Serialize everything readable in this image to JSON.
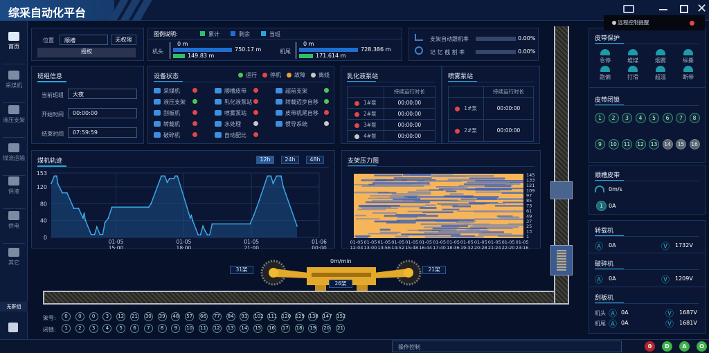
{
  "app": {
    "title": "综采自动化平台"
  },
  "toast": {
    "text": "远程控制提醒"
  },
  "sidebar": {
    "items": [
      {
        "label": "首页"
      },
      {
        "label": "采煤机"
      },
      {
        "label": "液压支架"
      },
      {
        "label": "煤流运输"
      },
      {
        "label": "供液"
      },
      {
        "label": "供电"
      },
      {
        "label": "其它"
      }
    ],
    "group": "无群组"
  },
  "position": {
    "label": "位置",
    "value": "顺槽",
    "permission": "无权限",
    "authorize": "授权"
  },
  "legend": {
    "title": "图例说明:",
    "items": [
      {
        "label": "累计",
        "color": "#2fbf6a"
      },
      {
        "label": "剩余",
        "color": "#1e6fd0"
      },
      {
        "label": "当班",
        "color": "#27a8d8"
      }
    ]
  },
  "head": {
    "label": "机头",
    "start": "0 m",
    "remaining": "750.17 m",
    "shift": "149.83 m"
  },
  "tail": {
    "label": "机尾",
    "start": "0 m",
    "remaining": "728.386 m",
    "shift": "171.614 m"
  },
  "rates": [
    {
      "label": "支架自动跟机率",
      "value": "0.00%"
    },
    {
      "label": "记 忆 截 割 率",
      "value": "0.00%"
    }
  ],
  "shift": {
    "title": "班组信息",
    "rows": [
      {
        "label": "当前班组",
        "value": "大夜"
      },
      {
        "label": "开始时间",
        "value": "00:00:00"
      },
      {
        "label": "结束时间",
        "value": "07:59:59"
      }
    ]
  },
  "devices": {
    "title": "设备状态",
    "legend": [
      {
        "label": "运行",
        "status": "green"
      },
      {
        "label": "停机",
        "status": "red"
      },
      {
        "label": "故障",
        "status": "orange"
      },
      {
        "label": "离线",
        "status": "gray"
      }
    ],
    "items": [
      {
        "label": "采煤机",
        "status": "red"
      },
      {
        "label": "顺槽皮带",
        "status": "red"
      },
      {
        "label": "超前支架",
        "status": "green"
      },
      {
        "label": "液压支架",
        "status": "green"
      },
      {
        "label": "乳化液泵站",
        "status": "red"
      },
      {
        "label": "转载迈步自移",
        "status": "green"
      },
      {
        "label": "刮板机",
        "status": "red"
      },
      {
        "label": "喷雾泵站",
        "status": "red"
      },
      {
        "label": "皮带机尾自移",
        "status": "red"
      },
      {
        "label": "转载机",
        "status": "red"
      },
      {
        "label": "水处理",
        "status": "gray"
      },
      {
        "label": "惯导系统",
        "status": "gray"
      },
      {
        "label": "破碎机",
        "status": "red"
      },
      {
        "label": "自动配比",
        "status": "red"
      }
    ]
  },
  "emulsion": {
    "title": "乳化液泵站",
    "header": "持续运行时长",
    "rows": [
      {
        "name": "1#泵",
        "status": "red",
        "time": "00:00:00"
      },
      {
        "name": "2#泵",
        "status": "red",
        "time": "00:00:00"
      },
      {
        "name": "3#泵",
        "status": "red",
        "time": "00:00:00"
      },
      {
        "name": "4#泵",
        "status": "gray",
        "time": "00:00:00"
      }
    ]
  },
  "spray": {
    "title": "喷雾泵站",
    "header": "持续运行时长",
    "rows": [
      {
        "name": "1#泵",
        "status": "red",
        "time": "00:00:00"
      },
      {
        "name": "2#泵",
        "status": "red",
        "time": "00:00:00"
      }
    ]
  },
  "chart_data": [
    {
      "type": "area",
      "title": "煤机轨迹",
      "ranges": [
        "12h",
        "24h",
        "48h"
      ],
      "active_range": "12h",
      "ylim": [
        0,
        153
      ],
      "yticks": [
        0,
        40,
        80,
        120,
        153
      ],
      "xlim": [
        12.1,
        24
      ],
      "xticks": [
        {
          "x": 15,
          "label": [
            "01-05",
            "15:00"
          ]
        },
        {
          "x": 18,
          "label": [
            "01-05",
            "18:00"
          ]
        },
        {
          "x": 21,
          "label": [
            "01-05",
            "21:00"
          ]
        },
        {
          "x": 24,
          "label": [
            "01-06",
            "00:00"
          ]
        }
      ],
      "x_unit": "hour",
      "points": [
        [
          12.13,
          128
        ],
        [
          12.27,
          146
        ],
        [
          12.37,
          146
        ],
        [
          12.42,
          128
        ],
        [
          12.62,
          106
        ],
        [
          12.83,
          106
        ],
        [
          13.13,
          69
        ],
        [
          13.34,
          69
        ],
        [
          13.54,
          46
        ],
        [
          13.59,
          58
        ],
        [
          13.64,
          41
        ],
        [
          13.9,
          7
        ],
        [
          14.05,
          7
        ],
        [
          14.15,
          25
        ],
        [
          14.29,
          7
        ],
        [
          14.41,
          7
        ],
        [
          14.51,
          35
        ],
        [
          14.66,
          46
        ],
        [
          14.82,
          72
        ],
        [
          16.45,
          72
        ],
        [
          16.55,
          80
        ],
        [
          17.01,
          146
        ],
        [
          17.16,
          146
        ],
        [
          17.27,
          131
        ],
        [
          17.37,
          140
        ],
        [
          17.57,
          140
        ],
        [
          17.62,
          146
        ],
        [
          17.72,
          146
        ],
        [
          18.29,
          46
        ],
        [
          18.34,
          52
        ],
        [
          18.39,
          41
        ],
        [
          18.64,
          6
        ],
        [
          18.74,
          6
        ],
        [
          18.85,
          27
        ],
        [
          18.95,
          15
        ],
        [
          19.05,
          6
        ],
        [
          19.15,
          6
        ],
        [
          19.26,
          32
        ],
        [
          20.94,
          32
        ],
        [
          21.1,
          52
        ],
        [
          21.35,
          89
        ],
        [
          21.71,
          146
        ],
        [
          21.86,
          146
        ],
        [
          21.96,
          128
        ],
        [
          22.11,
          146
        ],
        [
          22.31,
          146
        ],
        [
          22.41,
          120
        ],
        [
          23.02,
          27
        ]
      ]
    },
    {
      "type": "heatmap",
      "title": "支架压力图",
      "yticks": [
        "145",
        "133",
        "121",
        "109",
        "97",
        "85",
        "73",
        "61",
        "49",
        "37",
        "25",
        "13",
        "1"
      ],
      "xticks": [
        [
          "01-05",
          "12:04"
        ],
        [
          "01-05",
          "13:00"
        ],
        [
          "01-05",
          "13:56"
        ],
        [
          "01-05",
          "14:52"
        ],
        [
          "01-05",
          "15:48"
        ],
        [
          "01-05",
          "16:44"
        ],
        [
          "01-05",
          "17:40"
        ],
        [
          "01-05",
          "18:36"
        ],
        [
          "01-05",
          "19:32"
        ],
        [
          "01-05",
          "20:28"
        ],
        [
          "01-05",
          "21:24"
        ],
        [
          "01-05",
          "22:20"
        ],
        [
          "01-05",
          "23:16"
        ]
      ],
      "colors": {
        "high": "#f7b55a",
        "low": "#3f63b5"
      }
    }
  ],
  "shearer": {
    "speed": "0m/min",
    "left": "31架",
    "center": "26架",
    "right": "21架"
  },
  "rows": {
    "support_label": "架号:",
    "support": [
      "0",
      "0",
      "0",
      "3",
      "12",
      "21",
      "30",
      "39",
      "48",
      "57",
      "66",
      "77",
      "84",
      "93",
      "102",
      "111",
      "120",
      "129",
      "138",
      "147",
      "152"
    ],
    "lock_label": "闭锁:",
    "lock": [
      "1",
      "2",
      "3",
      "4",
      "5",
      "6",
      "7",
      "8",
      "9",
      "10",
      "11",
      "12",
      "13",
      "14",
      "15",
      "16",
      "17",
      "18",
      "19",
      "20",
      "21"
    ]
  },
  "belt_protect": {
    "title": "皮带保护",
    "items": [
      "急停",
      "堆煤",
      "烟雾",
      "纵撕",
      "跑偏",
      "打滑",
      "超温",
      "断带"
    ]
  },
  "belt_lock": {
    "title": "皮带闭锁",
    "items": [
      {
        "n": "1"
      },
      {
        "n": "2"
      },
      {
        "n": "3"
      },
      {
        "n": "4"
      },
      {
        "n": "5"
      },
      {
        "n": "6"
      },
      {
        "n": "7"
      },
      {
        "n": "8"
      },
      {
        "n": "9"
      },
      {
        "n": "10"
      },
      {
        "n": "11"
      },
      {
        "n": "12"
      },
      {
        "n": "13"
      },
      {
        "n": "14",
        "off": true
      },
      {
        "n": "15",
        "off": true
      },
      {
        "n": "16",
        "off": true
      }
    ]
  },
  "trough_belt": {
    "title": "顺槽皮带",
    "speed": "0m/s",
    "badge": "1",
    "current": "0A"
  },
  "transfer": {
    "title": "转载机",
    "current": "0A",
    "voltage": "1732V"
  },
  "crusher": {
    "title": "破碎机",
    "current": "0A",
    "voltage": "1209V"
  },
  "scraper": {
    "title": "刮板机",
    "head_label": "机头",
    "head_current": "0A",
    "head_voltage": "1687V",
    "tail_label": "机尾",
    "tail_current": "0A",
    "tail_voltage": "1681V"
  },
  "footer": {
    "control": "操作控制",
    "buttons": [
      {
        "label": "0",
        "color": "#b3262a"
      },
      {
        "label": "D",
        "color": "#3cb04a"
      },
      {
        "label": "A",
        "color": "#3cb04a"
      },
      {
        "label": "O",
        "color": "#3cb04a"
      }
    ]
  }
}
